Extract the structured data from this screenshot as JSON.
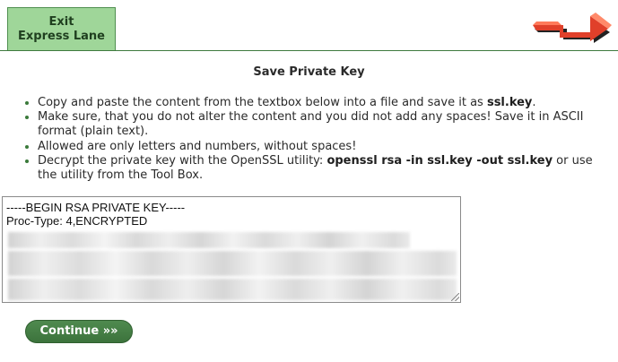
{
  "header": {
    "exit_line1": "Exit",
    "exit_line2": "Express Lane",
    "logo_icon": "brand-logo-icon"
  },
  "page_title": "Save Private Key",
  "instructions": [
    {
      "before": "Copy and paste the content from the textbox below into a file and save it as ",
      "bold": "ssl.key",
      "after": "."
    },
    {
      "before": "Make sure, that you do not alter the content and you did not add any spaces! Save it in ASCII format (plain text).",
      "bold": "",
      "after": ""
    },
    {
      "before": "Allowed are only letters and numbers, without spaces!",
      "bold": "",
      "after": ""
    },
    {
      "before": "Decrypt the private key with the OpenSSL utility: ",
      "bold": "openssl rsa -in ssl.key -out ssl.key",
      "after": " or use the utility from the Tool Box."
    }
  ],
  "key_textbox": {
    "line1": "-----BEGIN RSA PRIVATE KEY-----",
    "line2": "Proc-Type: 4,ENCRYPTED"
  },
  "continue_button": "Continue »»",
  "colors": {
    "accent_green": "#3c733c",
    "tab_green": "#9fd699"
  }
}
